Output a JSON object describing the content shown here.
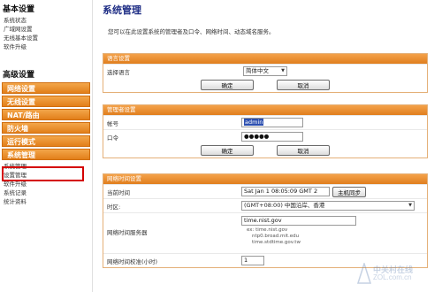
{
  "sidebar": {
    "basic_heading": "基本设置",
    "basic_items": [
      "系统状态",
      "广域网设置",
      "无线基本设置",
      "软件升级"
    ],
    "advanced_heading": "高级设置",
    "advanced_items": [
      "网络设置",
      "无线设置",
      "NAT/路由",
      "防火墙",
      "运行模式",
      "系统管理"
    ],
    "system_sub_items": [
      "系统管理",
      "设置管理",
      "软件升级",
      "系统记录",
      "统计资料"
    ]
  },
  "main": {
    "title": "系统管理",
    "description": "您可以在此设置系统的管理者及口令、网络时间、动态域名服务。",
    "language": {
      "heading": "语言设置",
      "label": "选择语言",
      "value": "简体中文",
      "ok": "确定",
      "cancel": "取消"
    },
    "admin": {
      "heading": "管理者设置",
      "account_label": "帐号",
      "account_value": "admin",
      "password_label": "口令",
      "password_value": "●●●●●",
      "ok": "确定",
      "cancel": "取消"
    },
    "ntp": {
      "heading": "网络时间设置",
      "current_time_label": "当前时间",
      "current_time_value": "Sat Jan  1 08:05:09 GMT 2",
      "sync_button": "主机同步",
      "timezone_label": "时区:",
      "timezone_value": "(GMT+08:00) 中国沿岸、香港",
      "server_label": "网络时间服务器",
      "server_value": "time.nist.gov",
      "examples": [
        "ex: time.nist.gov",
        "ntp0.broad.mit.edu",
        "time.stdtime.gov.tw"
      ],
      "sync_label": "网络时间校准(小时)",
      "sync_value": "1"
    }
  },
  "watermark": {
    "brand": "中关村在线",
    "url": "ZOL.com.cn"
  },
  "colors": {
    "accent_orange": "#e27f1a",
    "title_blue": "#1d2c84",
    "highlight_red": "#d40000"
  }
}
